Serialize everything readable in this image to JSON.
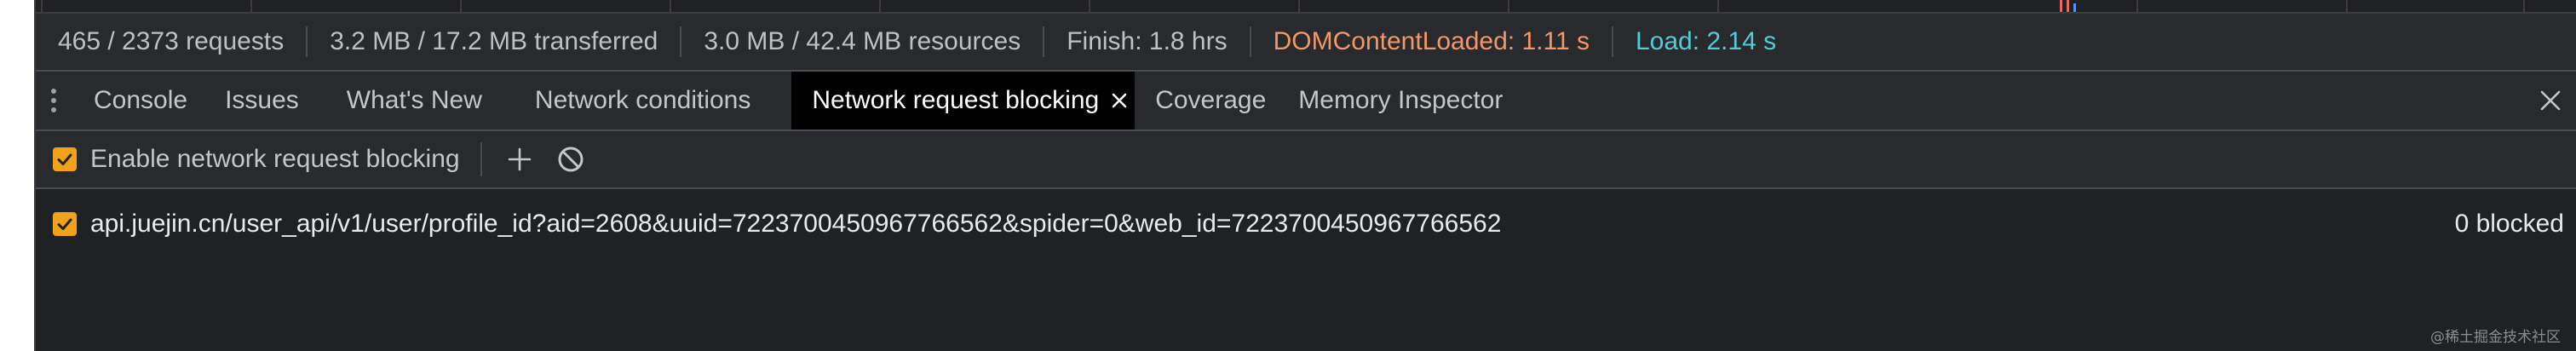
{
  "summary": {
    "requests": "465 / 2373 requests",
    "transferred": "3.2 MB / 17.2 MB transferred",
    "resources": "3.0 MB / 42.4 MB resources",
    "finish": "Finish: 1.8 hrs",
    "dom_content_loaded": "DOMContentLoaded: 1.11 s",
    "load": "Load: 2.14 s"
  },
  "tabs": [
    {
      "label": "Console"
    },
    {
      "label": "Issues"
    },
    {
      "label": "What's New"
    },
    {
      "label": "Network conditions"
    },
    {
      "label": "Network request blocking",
      "active": true
    },
    {
      "label": "Coverage"
    },
    {
      "label": "Memory Inspector"
    }
  ],
  "toolbar": {
    "enable_label": "Enable network request blocking",
    "enable_checked": true
  },
  "patterns": [
    {
      "url": "api.juejin.cn/user_api/v1/user/profile_id?aid=2608&uuid=7223700450967766562&spider=0&web_id=7223700450967766562",
      "checked": true,
      "blocked": "0 blocked"
    }
  ],
  "watermark": "@稀土掘金技术社区",
  "colors": {
    "background": "#202124",
    "toolbar": "#292a2d",
    "checkbox_accent": "#f2a21a",
    "dom_content_loaded": "#f29766",
    "load": "#4ecfd5"
  },
  "icons": [
    "kebab-menu-icon",
    "close-icon",
    "plus-icon",
    "block-icon",
    "checkmark-icon"
  ]
}
